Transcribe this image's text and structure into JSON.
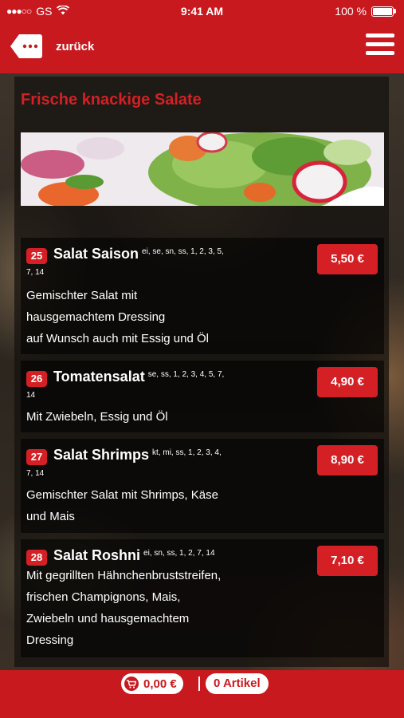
{
  "statusbar": {
    "carrier": "GS",
    "time": "9:41 AM",
    "battery": "100 %"
  },
  "navbar": {
    "back_label": "zurück"
  },
  "section": {
    "title": "Frische knackige Salate"
  },
  "items": [
    {
      "number": "25",
      "name": "Salat Saison",
      "allergens": "ei, se, sn, ss, 1, 2, 3, 5,",
      "allergens_cont": "7, 14",
      "desc": [
        "Gemischter Salat mit",
        "hausgemachtem Dressing",
        "auf Wunsch auch mit Essig und Öl"
      ],
      "price": "5,50 €"
    },
    {
      "number": "26",
      "name": "Tomatensalat",
      "allergens": "se, ss, 1, 2, 3, 4, 5, 7,",
      "allergens_cont": "14",
      "desc": [
        "Mit Zwiebeln, Essig und Öl"
      ],
      "price": "4,90 €"
    },
    {
      "number": "27",
      "name": "Salat Shrimps",
      "allergens": "kt, mi, ss, 1, 2, 3, 4,",
      "allergens_cont": "7, 14",
      "desc": [
        "Gemischter Salat mit Shrimps, Käse",
        "und Mais"
      ],
      "price": "8,90 €"
    },
    {
      "number": "28",
      "name": "Salat Roshni",
      "allergens": "ei, sn, ss, 1, 2, 7, 14",
      "allergens_cont": "",
      "desc": [
        "Mit gegrillten Hähnchenbruststreifen,",
        "frischen Champignons, Mais,",
        "Zwiebeln und hausgemachtem",
        "Dressing"
      ],
      "price": "7,10 €"
    }
  ],
  "footer": {
    "cart_total": "0,00 €",
    "article_count": "0 Artikel"
  },
  "colors": {
    "brand_red": "#c8191e",
    "badge_red": "#d42024"
  },
  "icons": [
    "back-arrow-icon",
    "menu-icon",
    "cart-icon",
    "wifi-icon",
    "battery-icon",
    "signal-dots-icon"
  ]
}
